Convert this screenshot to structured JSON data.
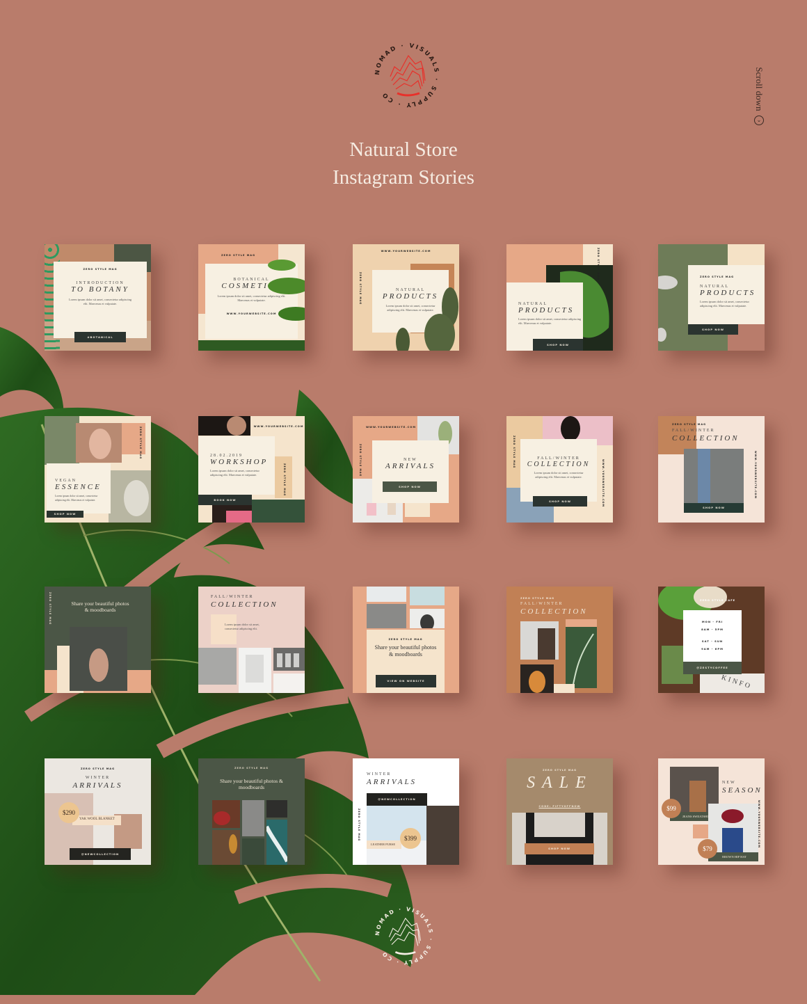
{
  "header": {
    "logo_text": "NOMAD · VISUALS · SUPPLY · CO",
    "title_line1": "Natural Store",
    "title_line2": "Instagram Stories",
    "scroll_label": "Scroll down",
    "scroll_icon": "chevron-down-circle-icon"
  },
  "colors": {
    "background": "#b97c6b",
    "cream": "#f7f0e2",
    "dark_button": "#2b3430",
    "olive": "#4b5646",
    "peach": "#e3a888",
    "tan": "#c18055",
    "logo_red": "#e8302a"
  },
  "cards": [
    {
      "mag": "ZERO STYLE MAG",
      "sub": "INTRODUCTION",
      "title": "TO BOTANY",
      "lorem": "Lorem ipsum dolor sit amet, consectetur adipiscing elit. Maecenas et vulputate.",
      "button": "#BOTANICAL"
    },
    {
      "mag": "ZERO STYLE MAG",
      "sub": "BOTANICAL",
      "title": "COSMETICS",
      "lorem": "Lorem ipsum dolor sit amet, consectetur adipiscing elit. Maecenas et vulputate.",
      "link": "WWW.YOURWEBSITE.COM"
    },
    {
      "link": "WWW.YOURWEBSITE.COM",
      "vert": "ZERO STYLE MAG",
      "sub": "NATURAL",
      "title": "PRODUCTS",
      "lorem": "Lorem ipsum dolor sit amet, consectetur adipiscing elit. Maecenas et vulputate."
    },
    {
      "vert": "ZERO STYLE MAG",
      "sub": "NATURAL",
      "title": "PRODUCTS",
      "lorem": "Lorem ipsum dolor sit amet, consectetur adipiscing elit. Maecenas et vulputate.",
      "button": "SHOP NOW"
    },
    {
      "mag": "ZERO STYLE MAG",
      "sub": "NATURAL",
      "title": "PRODUCTS",
      "lorem": "Lorem ipsum dolor sit amet, consectetur adipiscing elit. Maecenas et vulputate.",
      "button": "SHOP NOW"
    },
    {
      "vert": "ZERO STYLE MAG",
      "sub": "VEGAN",
      "title": "ESSENCE",
      "lorem": "Lorem ipsum dolor sit amet, consectetur adipiscing elit. Maecenas et vulputate.",
      "button": "SHOP NOW"
    },
    {
      "link": "WWW.YOURWEBSITE.COM",
      "vert": "ZERO STYLE MAG",
      "sub": "28.02.2019",
      "title": "WORKSHOP",
      "lorem": "Lorem ipsum dolor sit amet, consectetur adipiscing elit. Maecenas et vulputate.",
      "button": "BOOK NOW"
    },
    {
      "link": "WWW.YOURWEBSITE.COM",
      "vert": "ZERO STYLE MAG",
      "sub": "NEW",
      "title": "ARRIVALS",
      "button": "SHOP NOW"
    },
    {
      "vert": "ZERO STYLE MAG",
      "vert2": "WWW.YOURWEBSITE.COM",
      "sub": "FALL/WINTER",
      "title": "COLLECTION",
      "lorem": "Lorem ipsum dolor sit amet, consectetur adipiscing elit. Maecenas et vulputate.",
      "button": "SHOP NOW"
    },
    {
      "mag": "ZERO STYLE MAG",
      "sub": "FALL/WINTER",
      "title": "COLLECTION",
      "vert": "WWW.YOURWEBSITE.COM",
      "button": "SHOP NOW"
    },
    {
      "vert": "ZERO STYLE MAG",
      "quote": "Share your beautiful photos & moodboards"
    },
    {
      "sub": "FALL/WINTER",
      "title": "COLLECTION",
      "lorem": "Lorem ipsum dolor sit amet, consectetur adipiscing elit."
    },
    {
      "mag": "ZERO STYLE MAG",
      "quote": "Share your beautiful photos & moodboards",
      "button": "VIEW ON WEBSITE"
    },
    {
      "mag": "ZERO STYLE MAG",
      "sub": "FALL/WINTER",
      "title": "COLLECTION"
    },
    {
      "mag": "ZERO STYLE CAFE",
      "line1": "MON - FRI",
      "line2": "8AM - 5PM",
      "line3": "SAT - SUN",
      "line4": "9AM - 6PM",
      "button": "@ZESTYCOFFEE",
      "sign": "KINFO"
    },
    {
      "mag": "ZERO STYLE MAG",
      "sub": "WINTER",
      "title": "ARRIVALS",
      "price": "$290",
      "product": "YAK WOOL BLANKET",
      "button": "@NEWCOLLECTION"
    },
    {
      "mag": "ZERO STYLE MAG",
      "quote": "Share your beautiful photos & moodboards"
    },
    {
      "sub": "WINTER",
      "title": "ARRIVALS",
      "button": "@NEWCOLLECTION",
      "vert": "ZERO STYLE MAG",
      "price": "$399",
      "product": "LEATHER PURSE"
    },
    {
      "mag": "ZERO STYLE MAG",
      "title": "SALE",
      "code": "CODE: FIFTYOFFNOW",
      "button": "SHOP NOW"
    },
    {
      "sub": "NEW",
      "title": "SEASON",
      "vert": "WWW.YOURWEBSITE.COM",
      "price": "$99",
      "product": "JEANS SWEATSHIRT",
      "price2": "$79",
      "product2": "BROWN HIP HAT"
    }
  ]
}
